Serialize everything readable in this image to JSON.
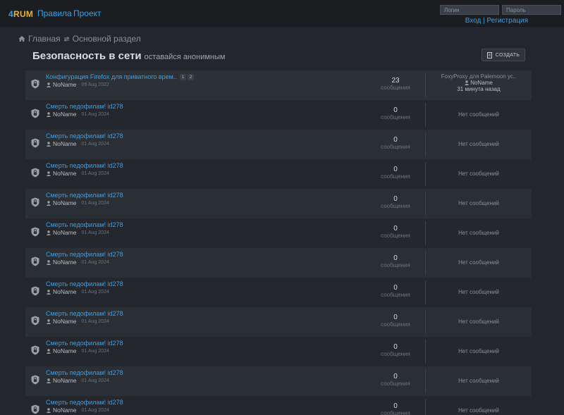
{
  "header": {
    "logo_a": "4",
    "logo_b": "RUM",
    "nav": [
      "Правила",
      "Проект"
    ],
    "login_placeholder": "Логин",
    "password_placeholder": "Пароль",
    "login_link": "Вход",
    "separator": "|",
    "register_link": "Регистрация"
  },
  "breadcrumb": {
    "home": "Главная",
    "section": "Основной раздел"
  },
  "forum": {
    "title": "Безопасность в сети",
    "subtitle": "оставайся анонимным",
    "create_label": "СОЗДАТЬ"
  },
  "topics": [
    {
      "title": "Конфигурация Firefox для приватного врем..",
      "pages": [
        "1",
        "2"
      ],
      "author": "NoName",
      "date": "09 Aug 2022",
      "count": "23",
      "count_label": "сообщения",
      "last_title": "FoxyProxy для Palemoon ус..",
      "last_user": "NoName",
      "last_when": "31 минута назад"
    },
    {
      "title": "Смерть педофилам! id278",
      "author": "NoName",
      "date": "01 Aug 2024",
      "count": "0",
      "count_label": "сообщения",
      "last_none": "Нет сообщений"
    },
    {
      "title": "Смерть педофилам! id278",
      "author": "NoName",
      "date": "01 Aug 2024",
      "count": "0",
      "count_label": "сообщения",
      "last_none": "Нет сообщений"
    },
    {
      "title": "Смерть педофилам! id278",
      "author": "NoName",
      "date": "01 Aug 2024",
      "count": "0",
      "count_label": "сообщения",
      "last_none": "Нет сообщений"
    },
    {
      "title": "Смерть педофилам! id278",
      "author": "NoName",
      "date": "01 Aug 2024",
      "count": "0",
      "count_label": "сообщения",
      "last_none": "Нет сообщений"
    },
    {
      "title": "Смерть педофилам! id278",
      "author": "NoName",
      "date": "01 Aug 2024",
      "count": "0",
      "count_label": "сообщения",
      "last_none": "Нет сообщений"
    },
    {
      "title": "Смерть педофилам! id278",
      "author": "NoName",
      "date": "01 Aug 2024",
      "count": "0",
      "count_label": "сообщения",
      "last_none": "Нет сообщений"
    },
    {
      "title": "Смерть педофилам! id278",
      "author": "NoName",
      "date": "01 Aug 2024",
      "count": "0",
      "count_label": "сообщения",
      "last_none": "Нет сообщений"
    },
    {
      "title": "Смерть педофилам! id278",
      "author": "NoName",
      "date": "01 Aug 2024",
      "count": "0",
      "count_label": "сообщения",
      "last_none": "Нет сообщений"
    },
    {
      "title": "Смерть педофилам! id278",
      "author": "NoName",
      "date": "01 Aug 2024",
      "count": "0",
      "count_label": "сообщения",
      "last_none": "Нет сообщений"
    },
    {
      "title": "Смерть педофилам! id278",
      "author": "NoName",
      "date": "01 Aug 2024",
      "count": "0",
      "count_label": "сообщения",
      "last_none": "Нет сообщений"
    },
    {
      "title": "Смерть педофилам! id278",
      "author": "NoName",
      "date": "01 Aug 2024",
      "count": "0",
      "count_label": "сообщения",
      "last_none": "Нет сообщений"
    }
  ],
  "icons": {
    "home": "home-icon",
    "transfer": "transfer-icon",
    "topic": "shield-lock-icon",
    "user": "user-icon",
    "create": "new-post-icon"
  },
  "colors": {
    "link": "#3ca0e6",
    "logo_accent": "#e7b23a",
    "background": "#23262c"
  }
}
